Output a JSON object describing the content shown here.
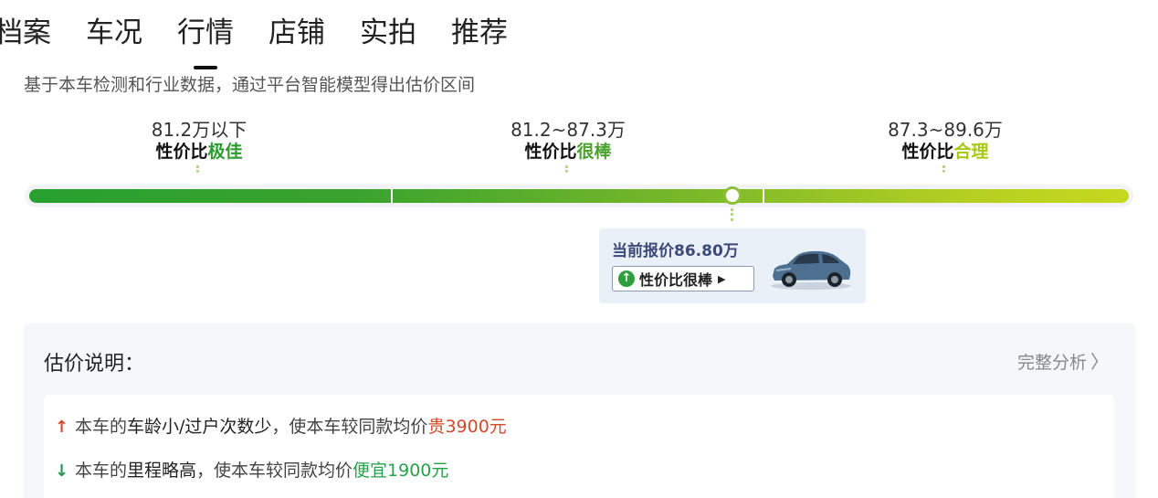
{
  "tabs": [
    {
      "label": "档案",
      "active": false
    },
    {
      "label": "车况",
      "active": false
    },
    {
      "label": "行情",
      "active": true
    },
    {
      "label": "店铺",
      "active": false
    },
    {
      "label": "实拍",
      "active": false
    },
    {
      "label": "推荐",
      "active": false
    }
  ],
  "subtitle": "基于本车检测和行业数据，通过平台智能模型得出估价区间",
  "levels": [
    {
      "range": "81.2万以下",
      "prefix": "性价比",
      "rating": "极佳",
      "color": "#2e9b2e"
    },
    {
      "range": "81.2~87.3万",
      "prefix": "性价比",
      "rating": "很棒",
      "color": "#4aa22e"
    },
    {
      "range": "87.3~89.6万",
      "prefix": "性价比",
      "rating": "合理",
      "color": "#a8c816"
    }
  ],
  "current": {
    "price_text": "当前报价86.80万",
    "badge_label": "性价比很棒",
    "badge_icon": "up-arrow-circle-icon",
    "badge_chevron": "play-triangle-icon",
    "car_image": "suv-car-icon"
  },
  "explain": {
    "title": "估价说明：",
    "full_link": "完整分析",
    "rows": [
      {
        "direction": "up",
        "icon": "arrow-up-icon",
        "prefix": "本车的",
        "highlight": "车龄小/过户次数少",
        "middle": "，使本车较同款均价",
        "impact": "贵3900元"
      },
      {
        "direction": "down",
        "icon": "arrow-down-icon",
        "prefix": "本车的",
        "highlight": "里程略高",
        "middle": "，使本车较同款均价",
        "impact": "便宜1900元"
      }
    ]
  },
  "colors": {
    "bar_start": "#27a02f",
    "bar_end": "#c6d81e",
    "price_text": "#3b4a78",
    "up_red": "#d24a2c",
    "down_green": "#27a24a"
  }
}
